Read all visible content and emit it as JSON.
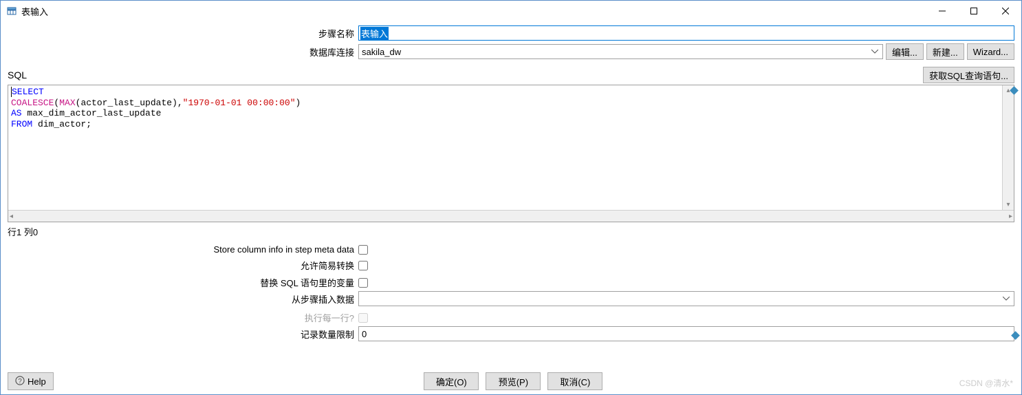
{
  "window": {
    "title": "表输入",
    "minimize": "—",
    "maximize": "□",
    "close": "✕"
  },
  "form": {
    "step_name_label": "步骤名称",
    "step_name_value": "表输入",
    "db_conn_label": "数据库连接",
    "db_conn_value": "sakila_dw",
    "edit_btn": "编辑...",
    "new_btn": "新建...",
    "wizard_btn": "Wizard..."
  },
  "sql": {
    "label": "SQL",
    "get_sql_btn": "获取SQL查询语句...",
    "tokens": {
      "select": "SELECT",
      "coalesce": "COALESCE",
      "paren1": "(",
      "max": "MAX",
      "paren2": "(actor_last_update),",
      "str": "\"1970-01-01 00:00:00\"",
      "paren3": ")",
      "as": "AS",
      "alias": " max_dim_actor_last_update",
      "from": "FROM",
      "table": " dim_actor;"
    },
    "status": "行1 列0"
  },
  "options": {
    "store_meta": "Store column info in step meta data",
    "allow_lazy": "允许简易转换",
    "replace_vars": "替换 SQL 语句里的变量",
    "insert_from_step": "从步骤插入数据",
    "execute_each_row": "执行每一行?",
    "record_limit_label": "记录数量限制",
    "record_limit_value": "0"
  },
  "buttons": {
    "help": "Help",
    "ok": "确定(O)",
    "preview": "预览(P)",
    "cancel": "取消(C)"
  },
  "watermark": "CSDN @清水*"
}
